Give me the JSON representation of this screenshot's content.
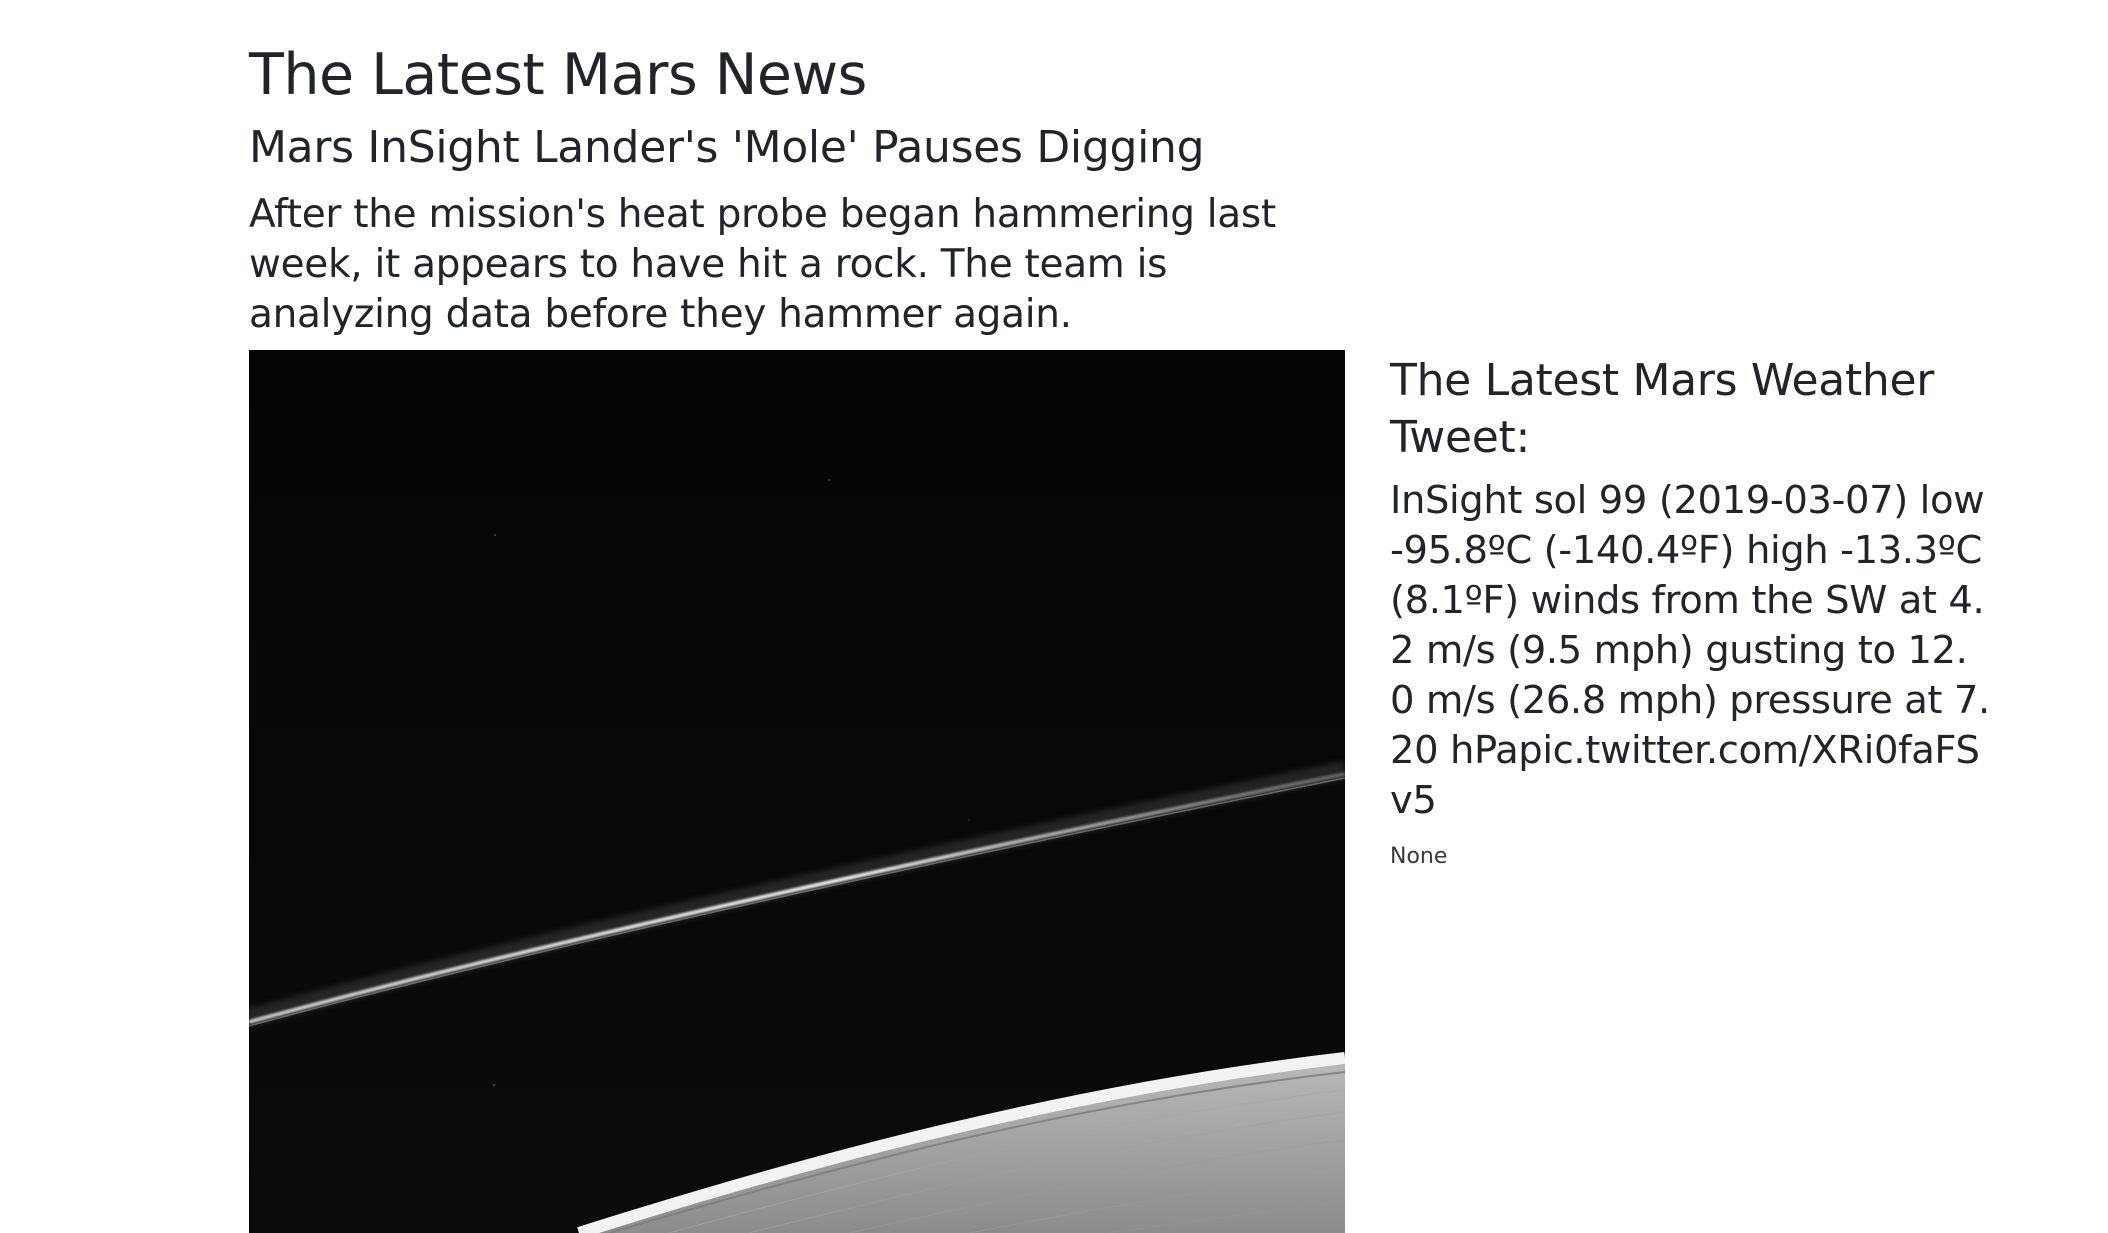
{
  "news": {
    "heading": "The Latest Mars News",
    "title": "Mars InSight Lander's 'Mole' Pauses Digging",
    "teaser": "After the mission's heat probe began hammering last week, it appears to have hit a rock. The team is analyzing data before they hammer again."
  },
  "weather": {
    "heading": "The Latest Mars Weather Tweet:",
    "tweet": "InSight sol 99 (2019-03-07) low -95.8ºC (-140.4ºF) high -13.3ºC (8.1ºF) winds from the SW at 4.2 m/s (9.5 mph) gusting to 12.0 m/s (26.8 mph) pressure at 7.20 hPapic.twitter.com/XRi0faFSv5",
    "extra": "None"
  },
  "image": {
    "subject": "ringed-planet-grayscale-photo"
  }
}
